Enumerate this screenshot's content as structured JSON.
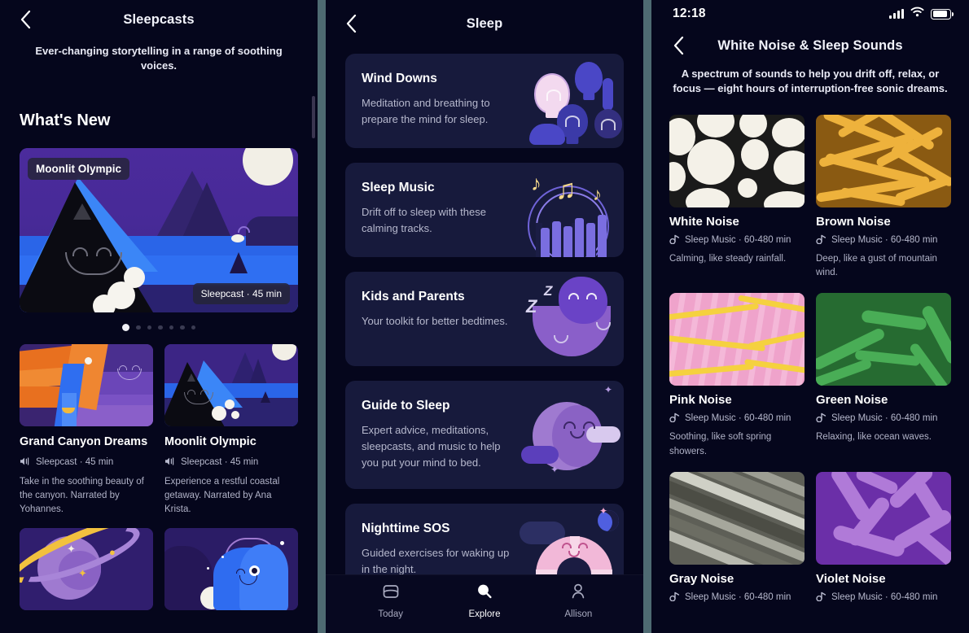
{
  "panel_sleepcasts": {
    "nav": {
      "back_icon": "chevron-left-icon",
      "title": "Sleepcasts"
    },
    "subtitle": "Ever-changing storytelling in a range of soothing voices.",
    "section_title": "What's New",
    "featured": {
      "title": "Moonlit Olympic",
      "meta": "Sleepcast · 45 min"
    },
    "carousel": {
      "dot_count": 7,
      "active_index": 0
    },
    "tiles": [
      {
        "title": "Grand Canyon Dreams",
        "meta_icon": "speaker-icon",
        "meta": "Sleepcast · 45 min",
        "desc": "Take in the soothing beauty of the canyon. Narrated by Yohannes."
      },
      {
        "title": "Moonlit Olympic",
        "meta_icon": "speaker-icon",
        "meta": "Sleepcast · 45 min",
        "desc": "Experience a restful coastal getaway. Narrated by Ana Krista."
      }
    ]
  },
  "panel_sleep": {
    "nav": {
      "back_icon": "chevron-left-icon",
      "title": "Sleep"
    },
    "categories": [
      {
        "title": "Wind Downs",
        "desc": "Meditation and breathing to prepare the mind for sleep.",
        "art": "lightbulbs-art"
      },
      {
        "title": "Sleep Music",
        "desc": "Drift off to sleep with these calming tracks.",
        "art": "music-notes-art"
      },
      {
        "title": "Kids and Parents",
        "desc": "Your toolkit for better bedtimes.",
        "art": "sleeping-moon-art"
      },
      {
        "title": "Guide to Sleep",
        "desc": "Expert advice, meditations, sleepcasts, and music to help you put your mind to bed.",
        "art": "moon-clouds-art"
      },
      {
        "title": "Nighttime SOS",
        "desc": "Guided exercises for waking up in the night.",
        "art": "life-ring-art"
      }
    ],
    "tabs": [
      {
        "label": "Today",
        "icon": "today-card-icon",
        "active": false
      },
      {
        "label": "Explore",
        "icon": "search-icon",
        "active": true
      },
      {
        "label": "Allison",
        "icon": "person-icon",
        "active": false
      }
    ]
  },
  "panel_noise": {
    "status": {
      "time": "12:18",
      "signal_icon": "cellular-signal-icon",
      "wifi_icon": "wifi-icon",
      "battery_icon": "battery-icon"
    },
    "nav": {
      "back_icon": "chevron-left-icon",
      "title": "White Noise & Sleep Sounds"
    },
    "subtitle": "A spectrum of sounds to help you drift off, relax, or focus — eight hours of interruption-free sonic dreams.",
    "cards": [
      {
        "title": "White Noise",
        "meta_icon": "music-note-icon",
        "meta": "Sleep Music · 60-480 min",
        "desc": "Calming, like steady rainfall.",
        "art": "white-bubbles-art",
        "color": "#f4f1e8"
      },
      {
        "title": "Brown Noise",
        "meta_icon": "music-note-icon",
        "meta": "Sleep Music · 60-480 min",
        "desc": "Deep, like a gust of mountain wind.",
        "art": "brown-scribble-art",
        "color": "#eeb23c"
      },
      {
        "title": "Pink Noise",
        "meta_icon": "music-note-icon",
        "meta": "Sleep Music · 60-480 min",
        "desc": "Soothing, like soft spring showers.",
        "art": "pink-waves-art",
        "color": "#efa3cb"
      },
      {
        "title": "Green Noise",
        "meta_icon": "music-note-icon",
        "meta": "Sleep Music · 60-480 min",
        "desc": "Relaxing, like ocean waves.",
        "art": "green-brush-art",
        "color": "#49ad56"
      },
      {
        "title": "Gray Noise",
        "meta_icon": "music-note-icon",
        "meta": "Sleep Music · 60-480 min",
        "desc": "",
        "art": "gray-brush-art",
        "color": "#8e8f86"
      },
      {
        "title": "Violet Noise",
        "meta_icon": "music-note-icon",
        "meta": "Sleep Music · 60-480 min",
        "desc": "",
        "art": "violet-brush-art",
        "color": "#b07ad8"
      }
    ]
  },
  "theme": {
    "background": "#05061c",
    "card_background": "#171a3c",
    "divider": "#4e6a72",
    "text_primary": "#ffffff",
    "text_secondary": "#b0b2c7"
  }
}
